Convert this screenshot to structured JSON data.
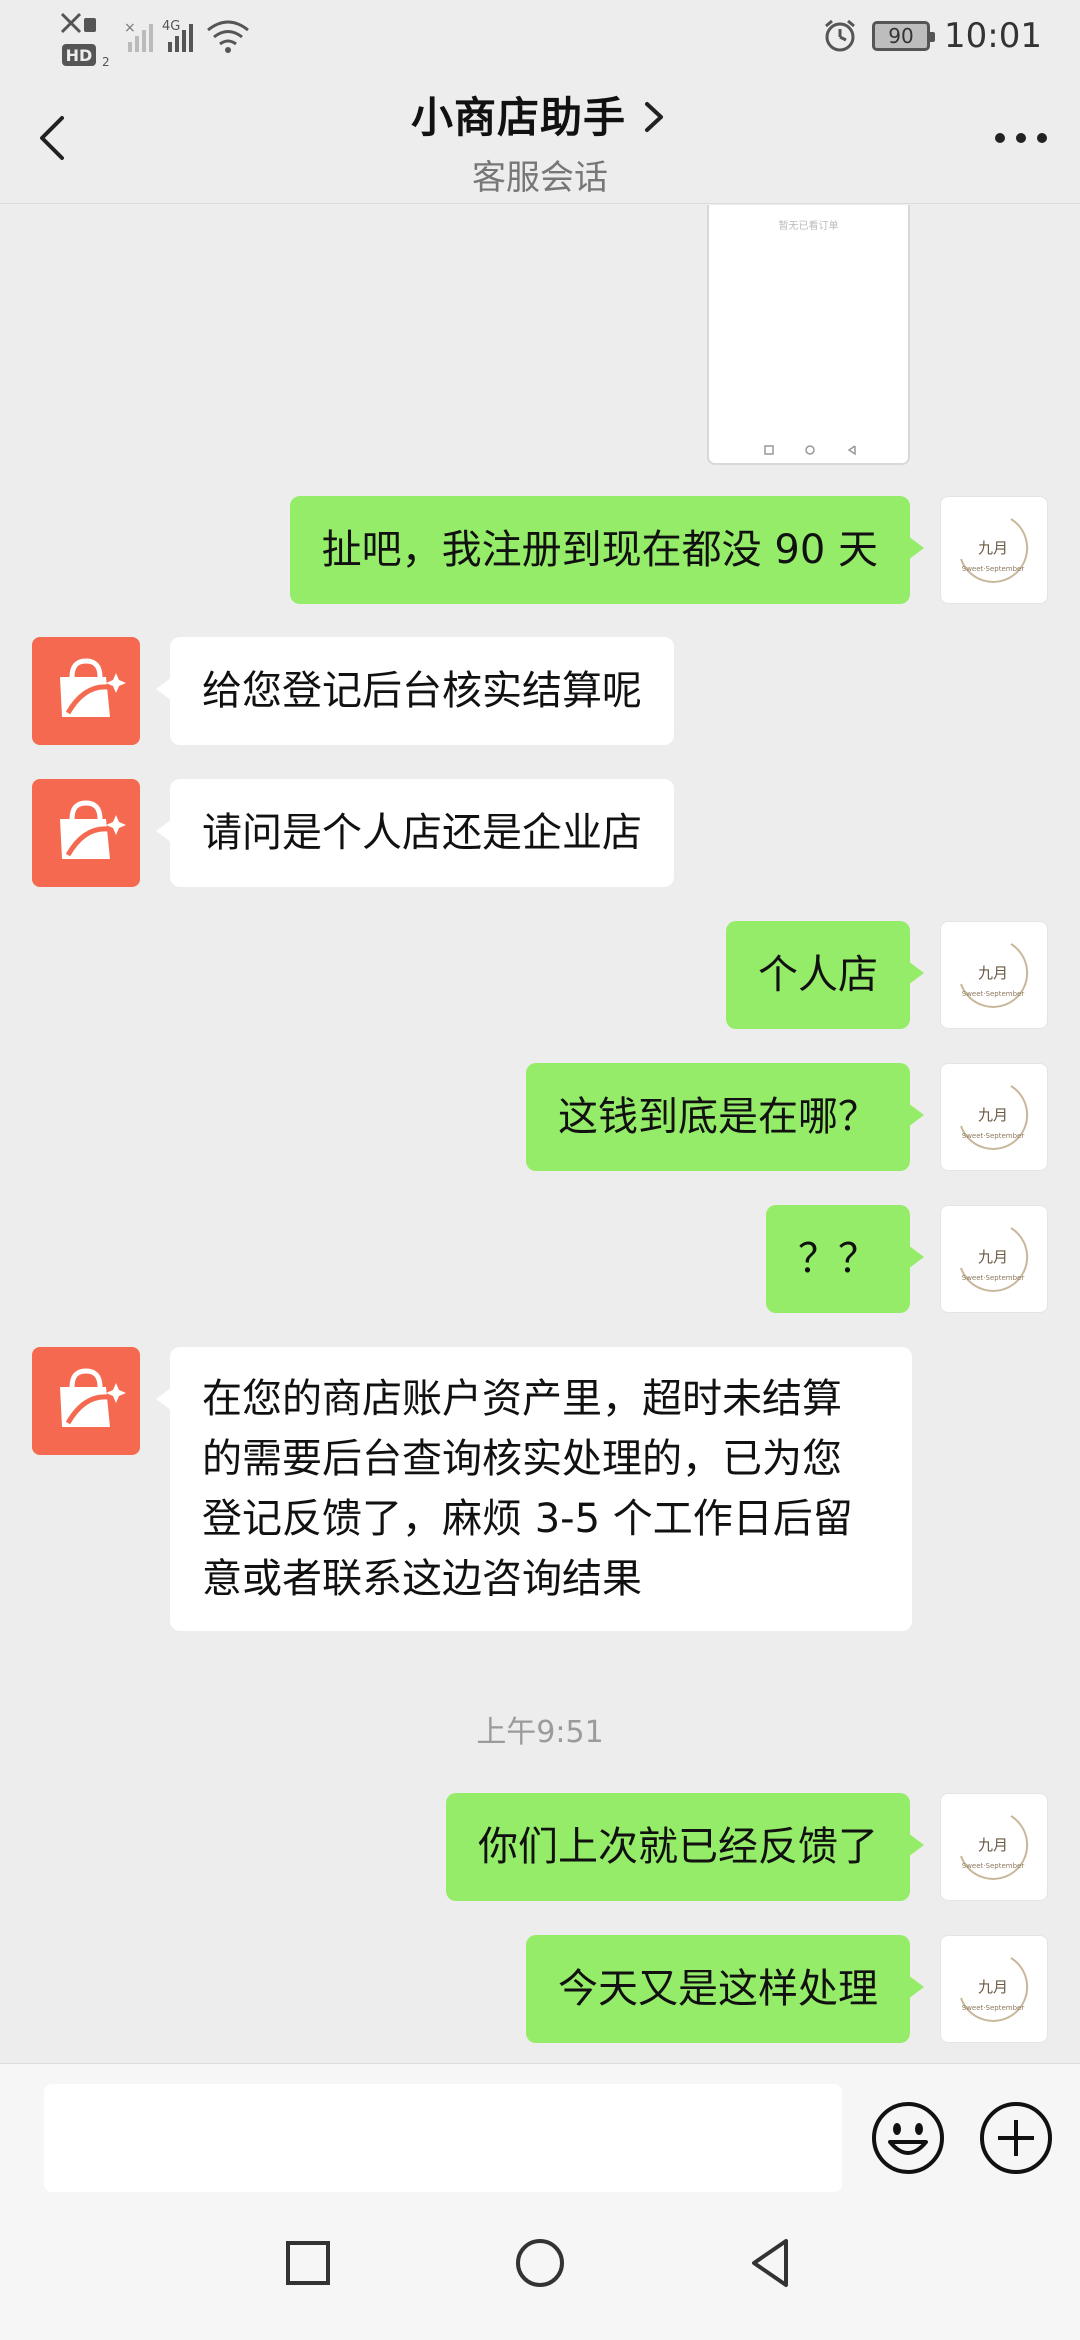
{
  "status_bar": {
    "left_indicators": [
      "HD",
      "4G"
    ],
    "battery": "90",
    "time": "10:01"
  },
  "nav": {
    "title": "小商店助手",
    "subtitle": "客服会话"
  },
  "image_message": {
    "caption_text": "暂无已看订单"
  },
  "messages": [
    {
      "side": "me",
      "text": "扯吧，我注册到现在都没 90 天"
    },
    {
      "side": "bot",
      "text": "给您登记后台核实结算呢"
    },
    {
      "side": "bot",
      "text": "请问是个人店还是企业店"
    },
    {
      "side": "me",
      "text": "个人店"
    },
    {
      "side": "me",
      "text": "这钱到底是在哪？"
    },
    {
      "side": "me",
      "text": "？？"
    },
    {
      "side": "bot",
      "text": "在您的商店账户资产里，超时未结算的需要后台查询核实处理的，已为您登记反馈了，麻烦 3-5 个工作日后留意或者联系这边咨询结果"
    },
    {
      "side": "time",
      "text": "上午9:51"
    },
    {
      "side": "me",
      "text": "你们上次就已经反馈了"
    },
    {
      "side": "me",
      "text": "今天又是这样处理"
    }
  ],
  "input": {
    "value": "",
    "placeholder": ""
  },
  "icons": {
    "back": "back-arrow-icon",
    "more": "more-dots-icon",
    "emoji": "emoji-icon",
    "plus": "plus-icon",
    "bot_avatar": "shopping-bag-icon",
    "user_avatar": "user-avatar-logo",
    "alarm": "alarm-icon",
    "wifi": "wifi-icon",
    "signal": "signal-icon"
  },
  "colors": {
    "my_bubble": "#95ec69",
    "bot_bubble": "#ffffff",
    "bot_avatar": "#f4694f",
    "background": "#ededed"
  }
}
